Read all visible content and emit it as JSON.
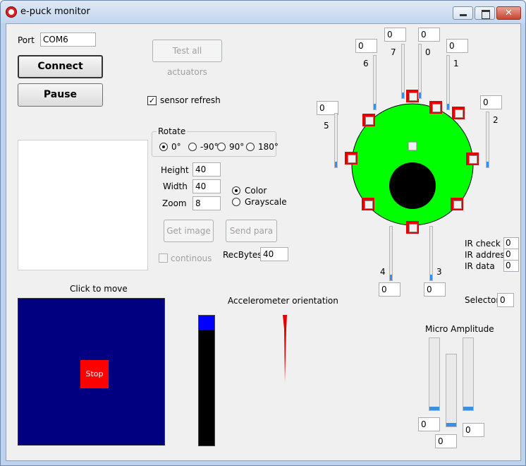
{
  "window": {
    "title": "e-puck monitor"
  },
  "connection": {
    "port_label": "Port",
    "port_value": "COM6",
    "connect_label": "Connect",
    "pause_label": "Pause"
  },
  "actuators": {
    "test_all_label": "Test all actuators"
  },
  "sensor_refresh": {
    "label": "sensor refresh",
    "checked": true
  },
  "rotate": {
    "title": "Rotate",
    "options": [
      "0°",
      "-90°",
      "90°",
      "180°"
    ],
    "selected": "0°"
  },
  "image_params": {
    "height_label": "Height",
    "height_value": "40",
    "width_label": "Width",
    "width_value": "40",
    "zoom_label": "Zoom",
    "zoom_value": "8",
    "color_label": "Color",
    "grayscale_label": "Grayscale",
    "mode_selected": "Color",
    "get_image_label": "Get image",
    "send_para_label": "Send para",
    "continuous_label": "continous",
    "recbytes_label": "RecBytes",
    "recbytes_value": "40"
  },
  "move_pad": {
    "title": "Click to move",
    "stop_label": "Stop",
    "pad_color": "#000080",
    "stop_color": "#ff0000"
  },
  "accelerometer": {
    "title": "Accelerometer orientation",
    "bar_fill_fraction": 0.11,
    "bar_color": "#0000ff",
    "needle_color": "#e40000"
  },
  "proximity": {
    "labels": {
      "s0": "0",
      "s1": "1",
      "s2": "2",
      "s3": "3",
      "s4": "4",
      "s5": "5",
      "s6": "6",
      "s7": "7"
    },
    "values": {
      "s0": "0",
      "s1": "0",
      "s2": "0",
      "s3": "0",
      "s4": "0",
      "s5": "0",
      "s6": "0",
      "s7": "0"
    },
    "body_color": "#00ff00",
    "sensor_color": "#e40000"
  },
  "ir": {
    "check_label": "IR check",
    "check_value": "0",
    "address_label": "IR address",
    "address_value": "0",
    "data_label": "IR data",
    "data_value": "0"
  },
  "selector": {
    "label": "Selector",
    "value": "0"
  },
  "micro": {
    "title": "Micro Amplitude",
    "values": [
      "0",
      "0",
      "0"
    ]
  },
  "colors": {
    "slider_fill": "#3b8fe0"
  }
}
